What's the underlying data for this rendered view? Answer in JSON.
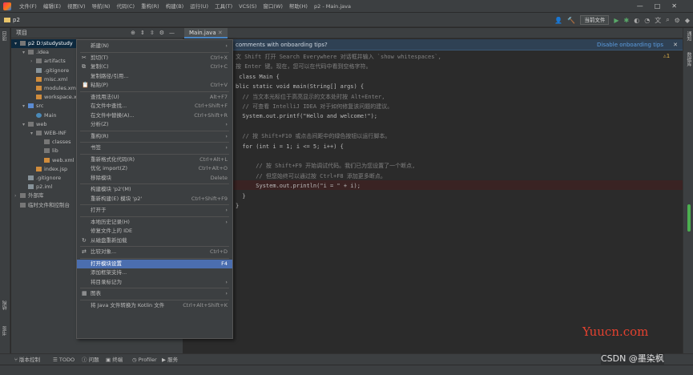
{
  "titlebar": {
    "menus": [
      "文件(F)",
      "编辑(E)",
      "视图(V)",
      "导航(N)",
      "代码(C)",
      "重构(R)",
      "构建(B)",
      "运行(U)",
      "工具(T)",
      "VCS(S)",
      "窗口(W)",
      "帮助(H)"
    ],
    "title": "p2 - Main.java"
  },
  "toolbar": {
    "breadcrumb": "p2",
    "run_config": "当前文件"
  },
  "left_strip": {
    "top_tab": "项目",
    "bottom_tab_1": "结构",
    "bottom_tab_2": "书签"
  },
  "right_strip": {
    "tab_1": "通知",
    "tab_2": "数据库"
  },
  "project_panel": {
    "title": "项目",
    "tree": [
      {
        "label": "p2  D:\\studystudy",
        "depth": 0,
        "icon": "folder",
        "expanded": true,
        "selected": true
      },
      {
        "label": ".idea",
        "depth": 1,
        "icon": "folder",
        "expanded": true
      },
      {
        "label": "artifacts",
        "depth": 2,
        "icon": "folder",
        "expanded": false
      },
      {
        "label": ".gitignore",
        "depth": 2,
        "icon": "file"
      },
      {
        "label": "misc.xml",
        "depth": 2,
        "icon": "xml"
      },
      {
        "label": "modules.xml",
        "depth": 2,
        "icon": "xml"
      },
      {
        "label": "workspace.xml",
        "depth": 2,
        "icon": "xml"
      },
      {
        "label": "src",
        "depth": 1,
        "icon": "source-folder",
        "expanded": true
      },
      {
        "label": "Main",
        "depth": 2,
        "icon": "class"
      },
      {
        "label": "web",
        "depth": 1,
        "icon": "folder",
        "expanded": true
      },
      {
        "label": "WEB-INF",
        "depth": 2,
        "icon": "folder",
        "expanded": true
      },
      {
        "label": "classes",
        "depth": 3,
        "icon": "folder"
      },
      {
        "label": "lib",
        "depth": 3,
        "icon": "folder"
      },
      {
        "label": "web.xml",
        "depth": 3,
        "icon": "xml"
      },
      {
        "label": "index.jsp",
        "depth": 2,
        "icon": "jsp"
      },
      {
        "label": ".gitignore",
        "depth": 1,
        "icon": "file"
      },
      {
        "label": "p2.iml",
        "depth": 1,
        "icon": "file"
      },
      {
        "label": "外部库",
        "depth": 0,
        "icon": "library",
        "expanded": false
      },
      {
        "label": "临时文件和控制台",
        "depth": 0,
        "icon": "scratch"
      }
    ]
  },
  "editor_tab": {
    "label": "Main.java"
  },
  "banner": {
    "text": "comments with onboarding tips?",
    "link": "Disable onboarding tips"
  },
  "editor": {
    "warning_count": "1",
    "lines": [
      "文 Shift 打开 Search Everywhere 对话框并输入 `show whitespaces`,",
      "按 Enter 键。现在，您可以在代码中看到空格字符。",
      " class Main {",
      "blic static void main(String[] args) {",
      "  // 当文本光标位于高亮显示的文本处时按 Alt+Enter,",
      "  // 可查看 IntelliJ IDEA 对于如何修复该问题的建议。",
      "  System.out.printf(\"Hello and welcome!\");",
      "",
      "  // 按 Shift+F10 或点击间距中的绿色按钮以运行脚本。",
      "  for (int i = 1; i <= 5; i++) {",
      "",
      "      // 按 Shift+F9 开始调试代码。我们已为您设置了一个断点,",
      "      // 但您始终可以通过按 Ctrl+F8 添加更多断点。",
      "      System.out.println(\"i = \" + i);",
      "  }",
      "}"
    ]
  },
  "context_menu": {
    "items": [
      {
        "label": "新建(N)",
        "shortcut": "",
        "submenu": true,
        "icon": ""
      },
      {
        "sep": true
      },
      {
        "label": "剪切(T)",
        "shortcut": "Ctrl+X",
        "icon": "cut"
      },
      {
        "label": "复制(C)",
        "shortcut": "Ctrl+C",
        "icon": "copy"
      },
      {
        "label": "复制路径/引用...",
        "shortcut": "",
        "icon": ""
      },
      {
        "label": "粘贴(P)",
        "shortcut": "Ctrl+V",
        "icon": "paste"
      },
      {
        "sep": true
      },
      {
        "label": "查找用法(U)",
        "shortcut": "Alt+F7",
        "icon": ""
      },
      {
        "label": "在文件中查找...",
        "shortcut": "Ctrl+Shift+F",
        "icon": ""
      },
      {
        "label": "在文件中替换(A)...",
        "shortcut": "Ctrl+Shift+R",
        "icon": ""
      },
      {
        "label": "分析(Z)",
        "shortcut": "",
        "submenu": true,
        "icon": ""
      },
      {
        "sep": true
      },
      {
        "label": "重构(R)",
        "shortcut": "",
        "submenu": true,
        "icon": ""
      },
      {
        "sep": true
      },
      {
        "label": "书签",
        "shortcut": "",
        "submenu": true,
        "icon": ""
      },
      {
        "sep": true
      },
      {
        "label": "重新格式化代码(R)",
        "shortcut": "Ctrl+Alt+L",
        "icon": ""
      },
      {
        "label": "优化 import(Z)",
        "shortcut": "Ctrl+Alt+O",
        "icon": ""
      },
      {
        "label": "移除模块",
        "shortcut": "Delete",
        "icon": ""
      },
      {
        "sep": true
      },
      {
        "label": "构建模块 'p2'(M)",
        "shortcut": "",
        "icon": ""
      },
      {
        "label": "重新构建(E) 模块 'p2'",
        "shortcut": "Ctrl+Shift+F9",
        "icon": ""
      },
      {
        "sep": true
      },
      {
        "label": "打开于",
        "shortcut": "",
        "submenu": true,
        "icon": ""
      },
      {
        "sep": true
      },
      {
        "label": "本地历史记录(H)",
        "shortcut": "",
        "submenu": true,
        "icon": ""
      },
      {
        "label": "修复文件上的 IDE",
        "shortcut": "",
        "icon": ""
      },
      {
        "label": "从磁盘重新加载",
        "shortcut": "",
        "icon": "reload"
      },
      {
        "sep": true
      },
      {
        "label": "比较对象...",
        "shortcut": "Ctrl+D",
        "icon": "compare"
      },
      {
        "sep": true
      },
      {
        "label": "打开模块设置",
        "shortcut": "F4",
        "icon": "",
        "highlighted": true
      },
      {
        "label": "添加框架支持...",
        "shortcut": "",
        "icon": ""
      },
      {
        "label": "将目录标记为",
        "shortcut": "",
        "submenu": true,
        "icon": ""
      },
      {
        "sep": true
      },
      {
        "label": "图表",
        "shortcut": "",
        "submenu": true,
        "icon": "diagram"
      },
      {
        "sep": true
      },
      {
        "label": "将 Java 文件转换为 Kotlin 文件",
        "shortcut": "Ctrl+Alt+Shift+K",
        "icon": ""
      }
    ]
  },
  "statusbar": {
    "items": [
      "版本控制",
      "TODO",
      "问题",
      "终端",
      "Profiler",
      "服务"
    ]
  },
  "watermarks": {
    "yuucn": "Yuucn.com",
    "csdn": "CSDN @墨染枫"
  },
  "colors": {
    "accent": "#4b6eaf",
    "selection": "#0d293e",
    "run_green": "#59a869"
  }
}
